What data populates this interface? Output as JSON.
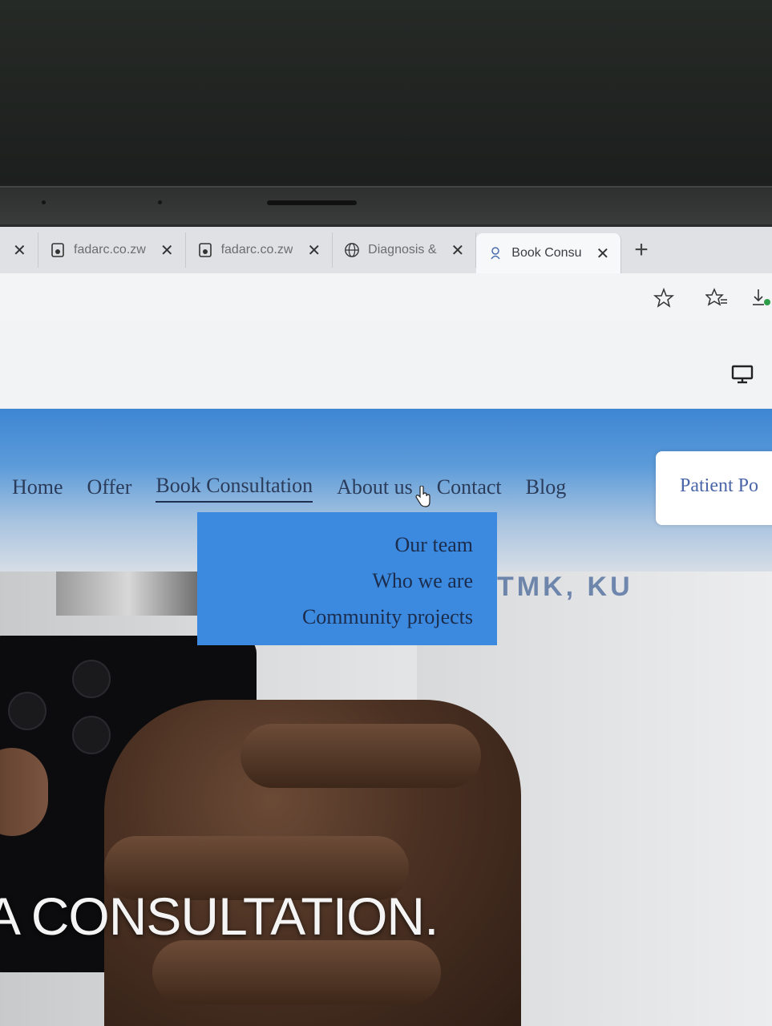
{
  "browser": {
    "tabs": [
      {
        "label": "",
        "icon": "close-icon"
      },
      {
        "label": "fadarc.co.zw",
        "icon": "document-icon"
      },
      {
        "label": "fadarc.co.zw",
        "icon": "document-icon"
      },
      {
        "label": "Diagnosis &",
        "icon": "globe-icon"
      },
      {
        "label": "Book Consu",
        "icon": "site-favicon",
        "active": true
      }
    ],
    "new_tab_symbol": "+",
    "toolbar_icons": [
      "star-icon",
      "favorites-icon",
      "download-icon"
    ],
    "page_icon": "monitor-icon"
  },
  "site": {
    "nav": [
      {
        "label": "Home"
      },
      {
        "label": "Offer"
      },
      {
        "label": "Book Consultation",
        "current": true
      },
      {
        "label": "About us",
        "hovered": true
      },
      {
        "label": "Contact"
      },
      {
        "label": "Blog"
      }
    ],
    "portal_button": "Patient Po",
    "dropdown": [
      "Our team",
      "Who we are",
      "Community projects"
    ],
    "hero_title": "A CONSULTATION.",
    "hero_logo_text": "TMK, KU"
  },
  "colors": {
    "header_blue": "#3d86d3",
    "dropdown_blue": "#3c8ae0",
    "nav_text": "#2b3c5a",
    "portal_text": "#4a66a8"
  }
}
